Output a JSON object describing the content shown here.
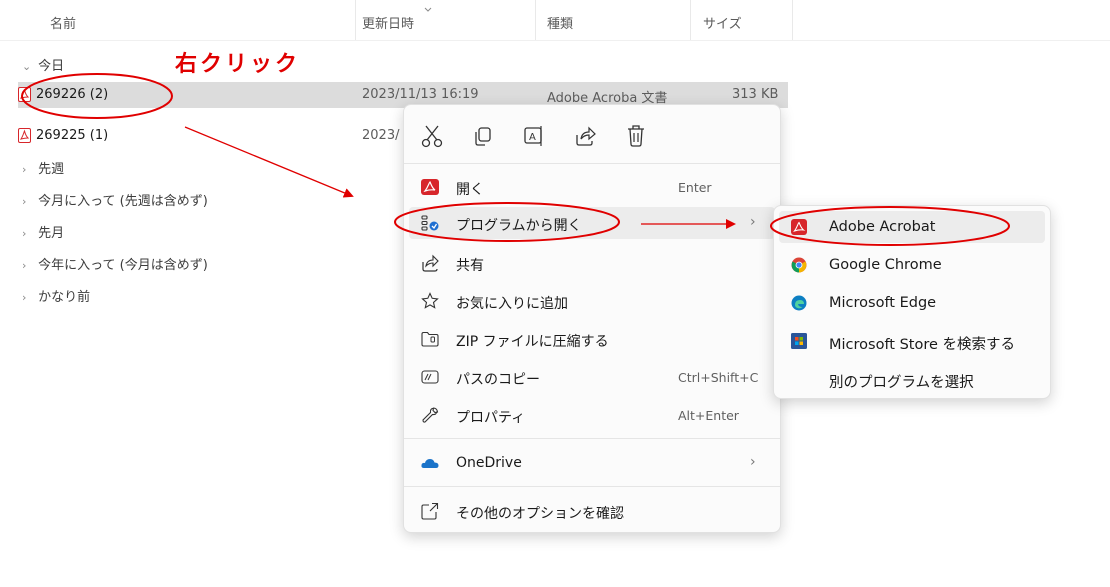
{
  "columns": {
    "name": "名前",
    "modified": "更新日時",
    "type": "種類",
    "size": "サイズ"
  },
  "groups": {
    "today": "今日",
    "last_week": "先週",
    "this_month": "今月に入って (先週は含めず)",
    "last_month": "先月",
    "this_year": "今年に入って (今月は含めず)",
    "long_ago": "かなり前"
  },
  "files": [
    {
      "name": "269226 (2)",
      "modified": "2023/11/13 16:19",
      "type": "Adobe Acroba 文書",
      "size": "313 KB",
      "selected": true
    },
    {
      "name": "269225 (1)",
      "modified": "2023/",
      "type": "",
      "size": "",
      "selected": false
    }
  ],
  "annotation": {
    "label": "右クリック",
    "color": "#e00000"
  },
  "context_menu": {
    "quick_actions": [
      "cut-icon",
      "copy-icon",
      "rename-icon",
      "share-icon",
      "delete-icon"
    ],
    "items": {
      "open": {
        "label": "開く",
        "shortcut": "Enter"
      },
      "open_with": {
        "label": "プログラムから開く",
        "arrow": "›"
      },
      "share": {
        "label": "共有"
      },
      "favorite": {
        "label": "お気に入りに追加"
      },
      "zip": {
        "label": "ZIP ファイルに圧縮する"
      },
      "copy_path": {
        "label": "パスのコピー",
        "shortcut": "Ctrl+Shift+C"
      },
      "properties": {
        "label": "プロパティ",
        "shortcut": "Alt+Enter"
      },
      "onedrive": {
        "label": "OneDrive",
        "arrow": "›"
      },
      "more_options": {
        "label": "その他のオプションを確認"
      }
    }
  },
  "submenu": {
    "items": [
      {
        "label": "Adobe Acrobat",
        "icon": "acrobat-icon"
      },
      {
        "label": "Google Chrome",
        "icon": "chrome-icon"
      },
      {
        "label": "Microsoft Edge",
        "icon": "edge-icon"
      },
      {
        "label": "Microsoft Store を検索する",
        "icon": "store-icon"
      },
      {
        "label": "別のプログラムを選択",
        "icon": ""
      }
    ]
  },
  "colors": {
    "annotation_red": "#e00000",
    "selected_row": "#dcdcdc",
    "menu_bg": "#fbfbfb",
    "acrobat_red": "#d7262b"
  }
}
